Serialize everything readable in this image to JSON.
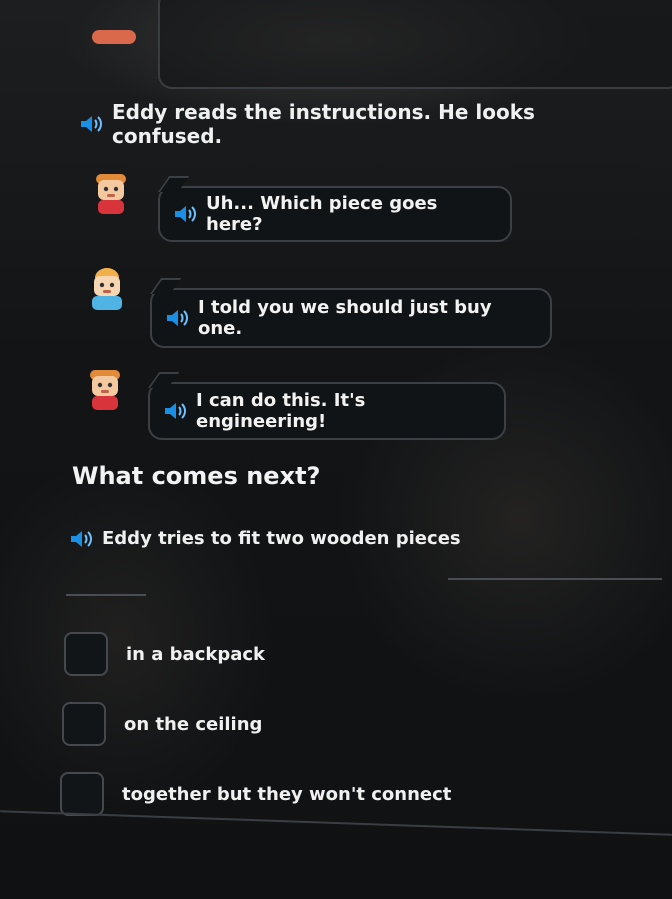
{
  "narration": "Eddy reads the instructions. He looks confused.",
  "dialogue": [
    {
      "speaker": "eddy",
      "text": "Uh... Which piece goes here?"
    },
    {
      "speaker": "friend",
      "text": "I told you we should just buy one."
    },
    {
      "speaker": "eddy",
      "text": "I can do this. It's engineering!"
    }
  ],
  "question": "What comes next?",
  "prompt": "Eddy tries to fit two wooden pieces",
  "options": [
    "in a backpack",
    "on the ceiling",
    "together but they won't connect"
  ],
  "colors": {
    "speaker_blue": "#1a8fe6",
    "speaker_light": "#6fc2ff",
    "eddy_hair": "#e08a3a",
    "friend_hair": "#f2b04a",
    "friend_shirt": "#4fb4e3",
    "eddy_shirt": "#d7343c"
  }
}
